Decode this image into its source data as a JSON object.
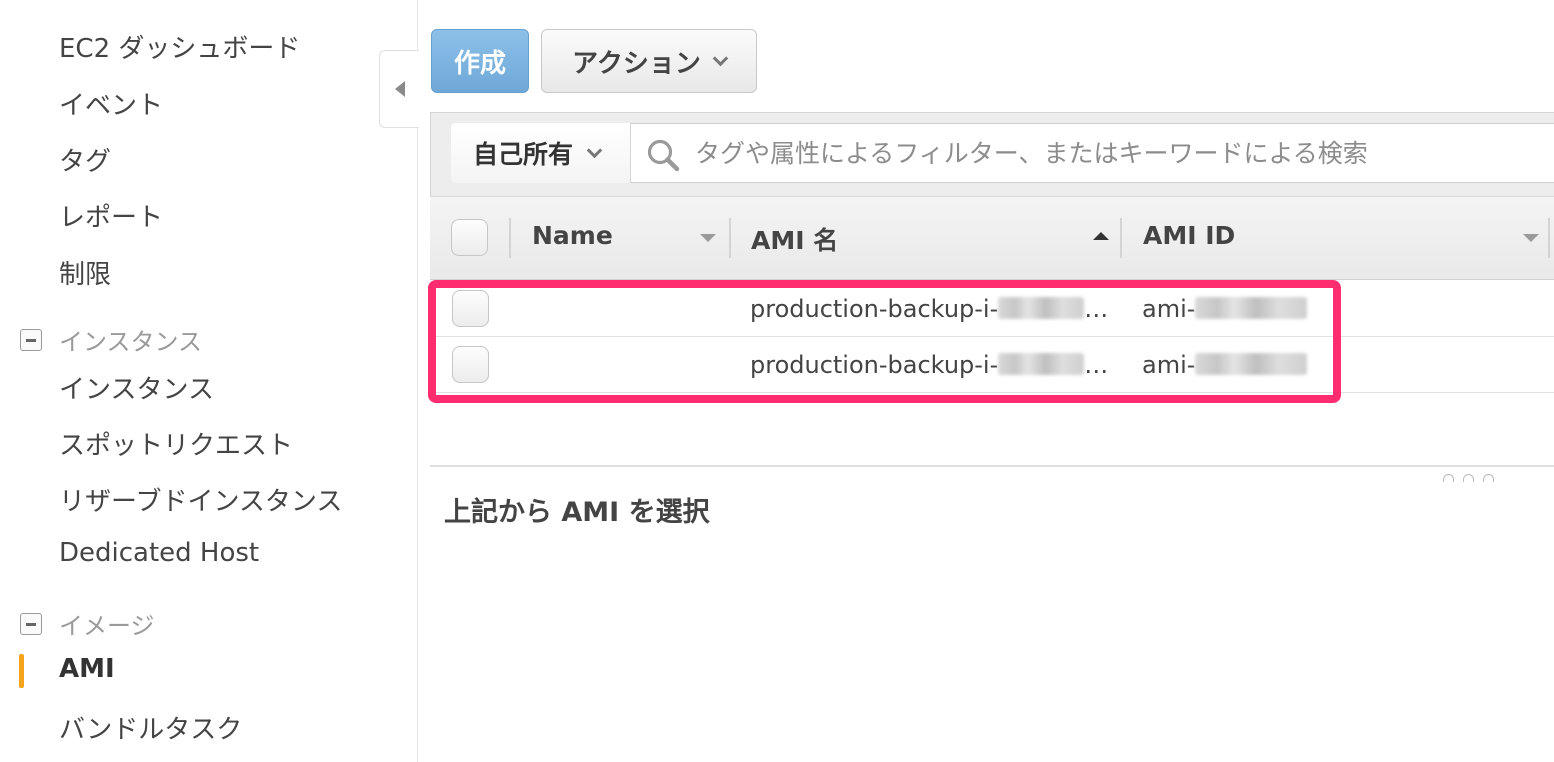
{
  "sidebar": {
    "items_top": [
      {
        "label": "EC2 ダッシュボード"
      },
      {
        "label": "イベント"
      },
      {
        "label": "タグ"
      },
      {
        "label": "レポート"
      },
      {
        "label": "制限"
      }
    ],
    "sections": [
      {
        "title": "インスタンス",
        "items": [
          {
            "label": "インスタンス"
          },
          {
            "label": "スポットリクエスト"
          },
          {
            "label": "リザーブドインスタンス"
          },
          {
            "label": "Dedicated Host"
          }
        ]
      },
      {
        "title": "イメージ",
        "items": [
          {
            "label": "AMI",
            "active": true
          },
          {
            "label": "バンドルタスク"
          }
        ]
      }
    ],
    "accent_color": "#f7a41d"
  },
  "toolbar": {
    "create_label": "作成",
    "action_label": "アクション"
  },
  "filter": {
    "owner_label": "自己所有",
    "search_placeholder": "タグや属性によるフィルター、またはキーワードによる検索"
  },
  "table": {
    "columns": [
      "Name",
      "AMI 名",
      "AMI ID"
    ],
    "sorted_column": "AMI 名",
    "rows": [
      {
        "name": "",
        "ami_name_visible": "production-backup-i-",
        "ami_id_visible": "ami-",
        "ellipsis": "…"
      },
      {
        "name": "",
        "ami_name_visible": "production-backup-i-",
        "ami_id_visible": "ami-",
        "ellipsis": "…"
      }
    ],
    "highlight_color": "#ff2d6f"
  },
  "detail": {
    "title": "上記から AMI を選択"
  },
  "colors": {
    "primary_button": "#7db4e0",
    "highlight": "#ff2d6f",
    "active_marker": "#f7a41d"
  }
}
